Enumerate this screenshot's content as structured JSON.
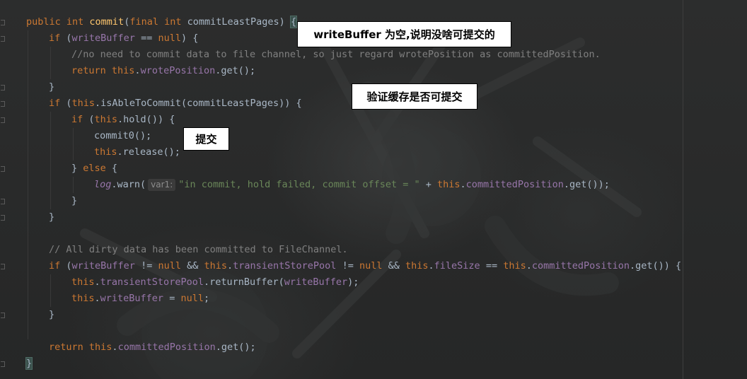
{
  "editor": {
    "lines": [
      {
        "tokens": [
          [
            "kw",
            "public "
          ],
          [
            "kw",
            "int "
          ],
          [
            "fn",
            "commit"
          ],
          [
            "p",
            "("
          ],
          [
            "kw",
            "final "
          ],
          [
            "kw",
            "int "
          ],
          [
            "p",
            "commitLeastPages) "
          ],
          [
            "hl",
            "{"
          ]
        ]
      },
      {
        "tokens": [
          [
            "kw",
            "if "
          ],
          [
            "p",
            "("
          ],
          [
            "fld",
            "writeBuffer"
          ],
          [
            "p",
            " == "
          ],
          [
            "kw",
            "null"
          ],
          [
            "p",
            ") {"
          ]
        ]
      },
      {
        "tokens": [
          [
            "cmt",
            "//no need to commit data to file channel, so just regard wrotePosition as committedPosition."
          ]
        ]
      },
      {
        "tokens": [
          [
            "kw",
            "return "
          ],
          [
            "kw",
            "this"
          ],
          [
            "p",
            "."
          ],
          [
            "fld",
            "wrotePosition"
          ],
          [
            "p",
            ".get();"
          ]
        ]
      },
      {
        "tokens": [
          [
            "p",
            "}"
          ]
        ]
      },
      {
        "tokens": [
          [
            "kw",
            "if "
          ],
          [
            "p",
            "("
          ],
          [
            "kw",
            "this"
          ],
          [
            "p",
            ".isAbleToCommit(commitLeastPages)) {"
          ]
        ]
      },
      {
        "tokens": [
          [
            "kw",
            "if "
          ],
          [
            "p",
            "("
          ],
          [
            "kw",
            "this"
          ],
          [
            "p",
            ".hold()) {"
          ]
        ]
      },
      {
        "tokens": [
          [
            "p",
            "commit0();"
          ]
        ]
      },
      {
        "tokens": [
          [
            "kw",
            "this"
          ],
          [
            "p",
            ".release();"
          ]
        ]
      },
      {
        "tokens": [
          [
            "p",
            "} "
          ],
          [
            "kw",
            "else "
          ],
          [
            "p",
            "{"
          ]
        ]
      },
      {
        "tokens": [
          [
            "si",
            "log"
          ],
          [
            "p",
            ".warn("
          ],
          [
            "hint",
            "var1:"
          ],
          [
            "str",
            "\"in commit, hold failed, commit offset = \""
          ],
          [
            "p",
            " + "
          ],
          [
            "kw",
            "this"
          ],
          [
            "p",
            "."
          ],
          [
            "fld",
            "committedPosition"
          ],
          [
            "p",
            ".get());"
          ]
        ]
      },
      {
        "tokens": [
          [
            "p",
            "}"
          ]
        ]
      },
      {
        "tokens": [
          [
            "p",
            "}"
          ]
        ]
      },
      {
        "tokens": []
      },
      {
        "tokens": [
          [
            "cmt",
            "// All dirty data has been committed to FileChannel."
          ]
        ]
      },
      {
        "tokens": [
          [
            "kw",
            "if "
          ],
          [
            "p",
            "("
          ],
          [
            "fld",
            "writeBuffer"
          ],
          [
            "p",
            " != "
          ],
          [
            "kw",
            "null "
          ],
          [
            "p",
            "&& "
          ],
          [
            "kw",
            "this"
          ],
          [
            "p",
            "."
          ],
          [
            "fld",
            "transientStorePool"
          ],
          [
            "p",
            " != "
          ],
          [
            "kw",
            "null "
          ],
          [
            "p",
            "&& "
          ],
          [
            "kw",
            "this"
          ],
          [
            "p",
            "."
          ],
          [
            "fld",
            "fileSize"
          ],
          [
            "p",
            " == "
          ],
          [
            "kw",
            "this"
          ],
          [
            "p",
            "."
          ],
          [
            "fld",
            "committedPosition"
          ],
          [
            "p",
            ".get()) {"
          ]
        ]
      },
      {
        "tokens": [
          [
            "kw",
            "this"
          ],
          [
            "p",
            "."
          ],
          [
            "fld",
            "transientStorePool"
          ],
          [
            "p",
            ".returnBuffer("
          ],
          [
            "fld",
            "writeBuffer"
          ],
          [
            "p",
            ");"
          ]
        ]
      },
      {
        "tokens": [
          [
            "kw",
            "this"
          ],
          [
            "p",
            "."
          ],
          [
            "fld",
            "writeBuffer"
          ],
          [
            "p",
            " = "
          ],
          [
            "kw",
            "null"
          ],
          [
            "p",
            ";"
          ]
        ]
      },
      {
        "tokens": [
          [
            "p",
            "}"
          ]
        ]
      },
      {
        "tokens": []
      },
      {
        "tokens": [
          [
            "kw",
            "return "
          ],
          [
            "kw",
            "this"
          ],
          [
            "p",
            "."
          ],
          [
            "fld",
            "committedPosition"
          ],
          [
            "p",
            ".get();"
          ]
        ]
      },
      {
        "tokens": [
          [
            "hl",
            "}"
          ]
        ]
      }
    ]
  },
  "callouts": {
    "write_buffer_null": "writeBuffer 为空,说明没啥可提交的",
    "verify_cache": "验证缓存是否可提交",
    "commit": "提交"
  },
  "colors": {
    "background": "#2b2b2b",
    "keyword": "#cc7832",
    "method_declaration": "#ffc66d",
    "field": "#9876aa",
    "string": "#6a8759",
    "comment": "#808080",
    "plain": "#a9b7c6",
    "callout_background": "#ffffff"
  }
}
